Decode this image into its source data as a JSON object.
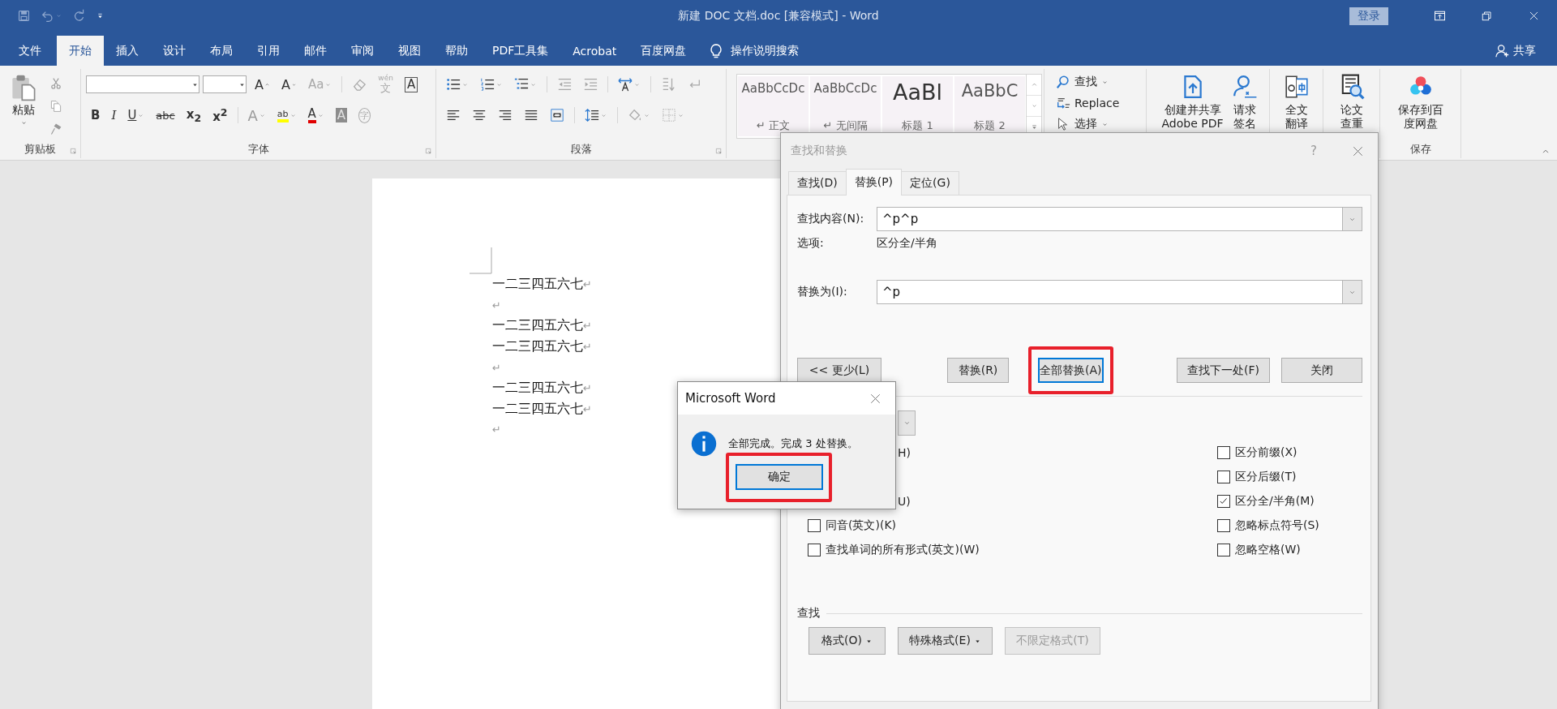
{
  "window": {
    "title": "新建 DOC 文档.doc [兼容模式]  -  Word",
    "login_button": "登录"
  },
  "menu_tabs": [
    {
      "label": "文件",
      "selected": false
    },
    {
      "label": "开始",
      "selected": true
    },
    {
      "label": "插入",
      "selected": false
    },
    {
      "label": "设计",
      "selected": false
    },
    {
      "label": "布局",
      "selected": false
    },
    {
      "label": "引用",
      "selected": false
    },
    {
      "label": "邮件",
      "selected": false
    },
    {
      "label": "审阅",
      "selected": false
    },
    {
      "label": "视图",
      "selected": false
    },
    {
      "label": "帮助",
      "selected": false
    },
    {
      "label": "PDF工具集",
      "selected": false
    },
    {
      "label": "Acrobat",
      "selected": false
    },
    {
      "label": "百度网盘",
      "selected": false
    }
  ],
  "tell_me": "操作说明搜索",
  "share_button": "共享",
  "ribbon": {
    "clipboard": {
      "paste": "粘贴",
      "label": "剪贴板"
    },
    "font": {
      "label": "字体",
      "row1": [
        {
          "kind": "grow",
          "text": "A",
          "dropdown": false,
          "disabled": false
        },
        {
          "kind": "shrink",
          "text": "A",
          "dropdown": false,
          "disabled": false
        },
        {
          "kind": "case",
          "text": "Aa",
          "dropdown": true,
          "disabled": true
        },
        {
          "kind": "clear",
          "dropdown": false,
          "disabled": true
        },
        {
          "kind": "phonetic",
          "text": "文",
          "ruby": "wén",
          "dropdown": false,
          "disabled": true
        },
        {
          "kind": "border",
          "text": "A",
          "dropdown": false,
          "disabled": false
        }
      ],
      "row2": [
        {
          "kind": "bold",
          "text": "B",
          "dropdown": false,
          "disabled": false
        },
        {
          "kind": "italic",
          "text": "I",
          "dropdown": false,
          "disabled": false
        },
        {
          "kind": "underline",
          "text": "U",
          "dropdown": true,
          "disabled": false
        },
        {
          "kind": "strike",
          "text": "abc",
          "dropdown": false,
          "disabled": false
        },
        {
          "kind": "sub",
          "text": "x$_{2}$",
          "dropdown": false,
          "disabled": false
        },
        {
          "kind": "sup",
          "text": "x$^{2}$",
          "dropdown": false,
          "disabled": false
        },
        {
          "kind": "effects",
          "text": "A",
          "dropdown": true,
          "disabled": true
        },
        {
          "kind": "highlight",
          "text": "ab",
          "dropdown": true,
          "disabled": false
        },
        {
          "kind": "color",
          "text": "A",
          "dropdown": true,
          "disabled": false
        },
        {
          "kind": "shade",
          "text": "A",
          "dropdown": false,
          "disabled": false
        },
        {
          "kind": "enclose",
          "text": "字",
          "dropdown": false,
          "disabled": true
        }
      ]
    },
    "paragraph": {
      "label": "段落",
      "row1": [
        {
          "kind": "bullets",
          "dropdown": true,
          "disabled": false
        },
        {
          "kind": "numbering",
          "dropdown": true,
          "disabled": false
        },
        {
          "kind": "multilevel",
          "dropdown": true,
          "disabled": false
        },
        {
          "kind": "outdent",
          "dropdown": false,
          "disabled": true
        },
        {
          "kind": "indent",
          "dropdown": false,
          "disabled": true
        },
        {
          "kind": "cnlayout",
          "dropdown": true,
          "disabled": false
        },
        {
          "kind": "sort",
          "dropdown": false,
          "disabled": true
        },
        {
          "kind": "marks",
          "dropdown": false,
          "disabled": true
        }
      ],
      "row2": [
        {
          "kind": "alignleft",
          "dropdown": false,
          "disabled": false
        },
        {
          "kind": "aligncenter",
          "dropdown": false,
          "disabled": false
        },
        {
          "kind": "alignright",
          "dropdown": false,
          "disabled": false
        },
        {
          "kind": "justify",
          "dropdown": false,
          "disabled": false
        },
        {
          "kind": "distribute",
          "dropdown": false,
          "disabled": false
        },
        {
          "kind": "linespacing",
          "dropdown": true,
          "disabled": false
        },
        {
          "kind": "shading",
          "dropdown": true,
          "disabled": true
        },
        {
          "kind": "borders",
          "dropdown": true,
          "disabled": true
        }
      ]
    },
    "styles": [
      {
        "kind": "body",
        "preview": "AaBbCcDc",
        "name": "↵ 正文"
      },
      {
        "kind": "body",
        "preview": "AaBbCcDc",
        "name": "↵ 无间隔"
      },
      {
        "kind": "heading1",
        "preview": "AaBl",
        "name": "标题 1"
      },
      {
        "kind": "heading2",
        "preview": "AaBbC",
        "name": "标题 2"
      }
    ],
    "editing": [
      {
        "kind": "find",
        "label": "查找",
        "dropdown": true
      },
      {
        "kind": "replace",
        "label": "Replace",
        "dropdown": false
      },
      {
        "kind": "select",
        "label": "选择",
        "dropdown": true
      }
    ],
    "groups": [
      {
        "buttons": [
          {
            "kind": "pdf",
            "label": "创建并共享 Adobe PDF"
          },
          {
            "kind": "sign",
            "label": "请求签名"
          }
        ]
      },
      {
        "buttons": [
          {
            "kind": "translate",
            "label": "全文翻译"
          }
        ]
      },
      {
        "buttons": [
          {
            "kind": "paper",
            "label": "论文查重"
          }
        ]
      },
      {
        "buttons": [
          {
            "kind": "cloud",
            "label": "保存到百度网盘"
          }
        ],
        "label": "保存"
      }
    ]
  },
  "document": {
    "lines": [
      {
        "text": "一二三四五六七",
        "mark": "↵"
      },
      {
        "mark": "↵"
      },
      {
        "text": "一二三四五六七",
        "mark": "↵"
      },
      {
        "text": "一二三四五六七",
        "mark": "↵"
      },
      {
        "mark": "↵"
      },
      {
        "text": "一二三四五六七",
        "mark": "↵"
      },
      {
        "text": "一二三四五六七",
        "mark": "↵"
      },
      {
        "mark": "↵"
      }
    ]
  },
  "find_dialog": {
    "title": "查找和替换",
    "help": "?",
    "tabs": [
      {
        "label": "查找(D)",
        "selected": false
      },
      {
        "label": "替换(P)",
        "selected": true
      },
      {
        "label": "定位(G)",
        "selected": false
      }
    ],
    "find_label": "查找内容(N):",
    "find_value": "^p^p",
    "options_label": "选项:",
    "options_value": "区分全/半角",
    "replace_label": "替换为(I):",
    "replace_value": "^p",
    "buttons": [
      {
        "label": "<< 更少(L)",
        "focused": false,
        "highlighted": false
      },
      {
        "label": "替换(R)",
        "focused": false,
        "highlighted": false
      },
      {
        "label": "全部替换(A)",
        "focused": true,
        "highlighted": true
      },
      {
        "label": "查找下一处(F)",
        "focused": false,
        "highlighted": false
      },
      {
        "label": "关闭",
        "focused": false,
        "highlighted": false
      }
    ],
    "left_options": [
      {
        "kind": "fragment",
        "label": "H)"
      },
      {
        "kind": "fragment",
        "label": "U)"
      },
      {
        "kind": "checkbox",
        "label": "同音(英文)(K)",
        "checked": false
      },
      {
        "kind": "checkbox",
        "label": "查找单词的所有形式(英文)(W)",
        "checked": false
      }
    ],
    "right_options": [
      {
        "kind": "checkbox",
        "label": "区分前缀(X)",
        "checked": false
      },
      {
        "kind": "checkbox",
        "label": "区分后缀(T)",
        "checked": false
      },
      {
        "kind": "checkbox",
        "label": "区分全/半角(M)",
        "checked": true
      },
      {
        "kind": "checkbox",
        "label": "忽略标点符号(S)",
        "checked": false
      },
      {
        "kind": "checkbox",
        "label": "忽略空格(W)",
        "checked": false
      }
    ],
    "format_label": "查找",
    "format_buttons": [
      {
        "label": "格式(O)",
        "dropdown": true,
        "disabled": false
      },
      {
        "label": "特殊格式(E)",
        "dropdown": true,
        "disabled": false
      },
      {
        "label": "不限定格式(T)",
        "dropdown": false,
        "disabled": true
      }
    ]
  },
  "message_box": {
    "title": "Microsoft Word",
    "message": "全部完成。完成 3 处替换。",
    "button": {
      "label": "确定",
      "focused": true,
      "highlighted": true
    }
  }
}
